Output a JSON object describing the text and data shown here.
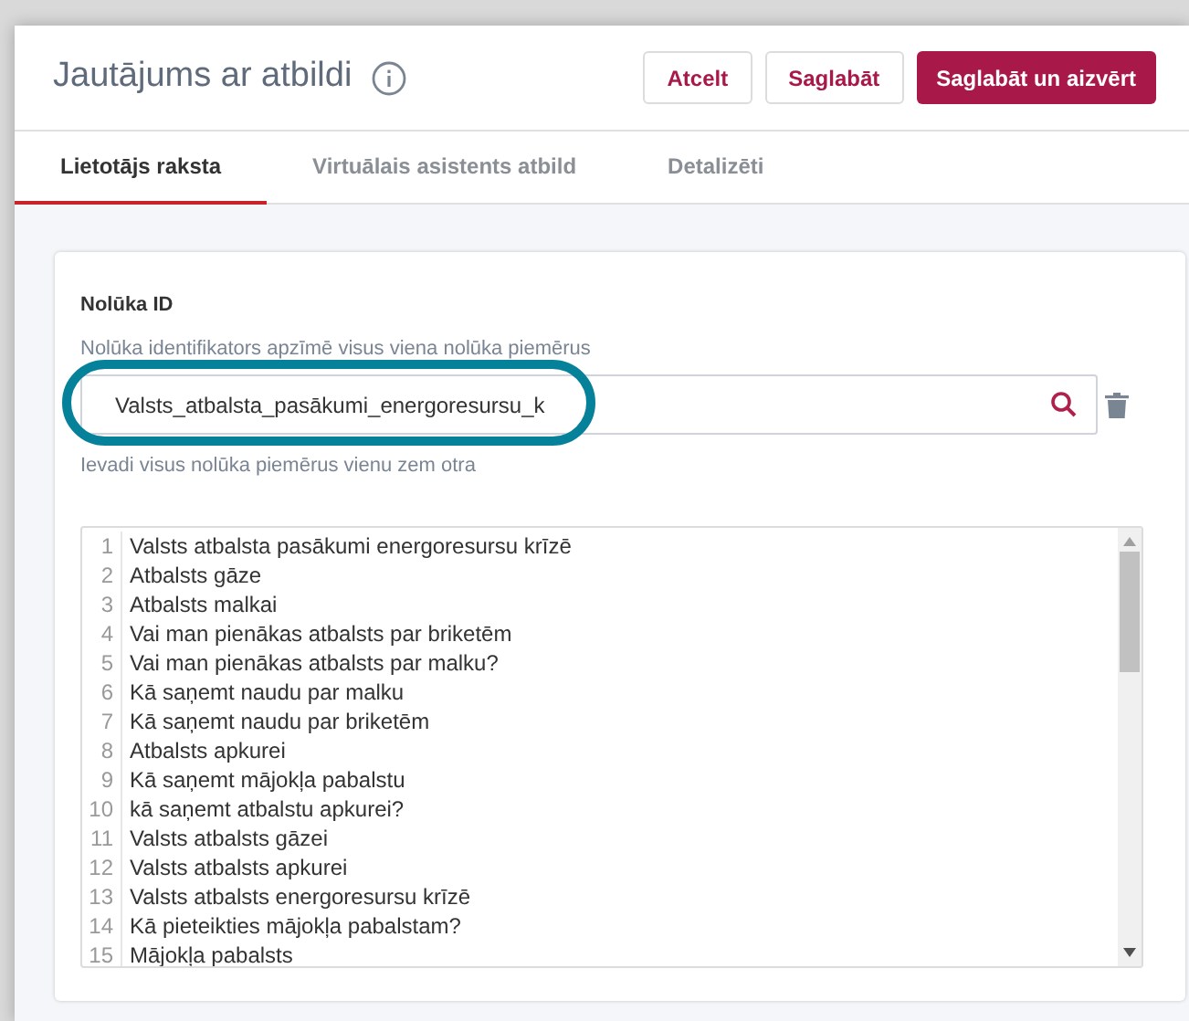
{
  "dialog": {
    "title": "Jautājums ar atbildi",
    "buttons": [
      {
        "label": "Atcelt",
        "kind": "secondary"
      },
      {
        "label": "Saglabāt",
        "kind": "secondary"
      },
      {
        "label": "Saglabāt un aizvērt",
        "kind": "primary"
      }
    ]
  },
  "tabs": [
    {
      "label": "Lietotājs raksta",
      "selected": true
    },
    {
      "label": "Virtuālais asistents atbild",
      "selected": false
    },
    {
      "label": "Detalizēti",
      "selected": false
    }
  ],
  "intent": {
    "label": "Nolūka ID",
    "description": "Nolūka identifikators apzīmē visus viena nolūka piemērus",
    "value": "Valsts_atbalsta_pasākumi_energoresursu_k",
    "highlighted": true,
    "helper": "Ievadi visus nolūka piemērus vienu zem otra"
  },
  "examples": [
    {
      "number": "1",
      "text": "Valsts atbalsta pasākumi energoresursu krīzē"
    },
    {
      "number": "2",
      "text": "Atbalsts gāze"
    },
    {
      "number": "3",
      "text": "Atbalsts malkai"
    },
    {
      "number": "4",
      "text": "Vai man pienākas atbalsts par briketēm"
    },
    {
      "number": "5",
      "text": "Vai man pienākas atbalsts par malku?"
    },
    {
      "number": "6",
      "text": "Kā saņemt naudu par malku"
    },
    {
      "number": "7",
      "text": "Kā saņemt naudu par briketēm"
    },
    {
      "number": "8",
      "text": "Atbalsts apkurei"
    },
    {
      "number": "9",
      "text": "Kā saņemt mājokļa pabalstu"
    },
    {
      "number": "10",
      "text": "kā saņemt atbalstu apkurei?"
    },
    {
      "number": "11",
      "text": "Valsts atbalsts gāzei"
    },
    {
      "number": "12",
      "text": "Valsts atbalsts apkurei"
    },
    {
      "number": "13",
      "text": "Valsts atbalsts energoresursu krīzē"
    },
    {
      "number": "14",
      "text": "Kā pieteikties mājokļa pabalstam?"
    },
    {
      "number": "15",
      "text": "Mājokļa pabalsts"
    }
  ]
}
